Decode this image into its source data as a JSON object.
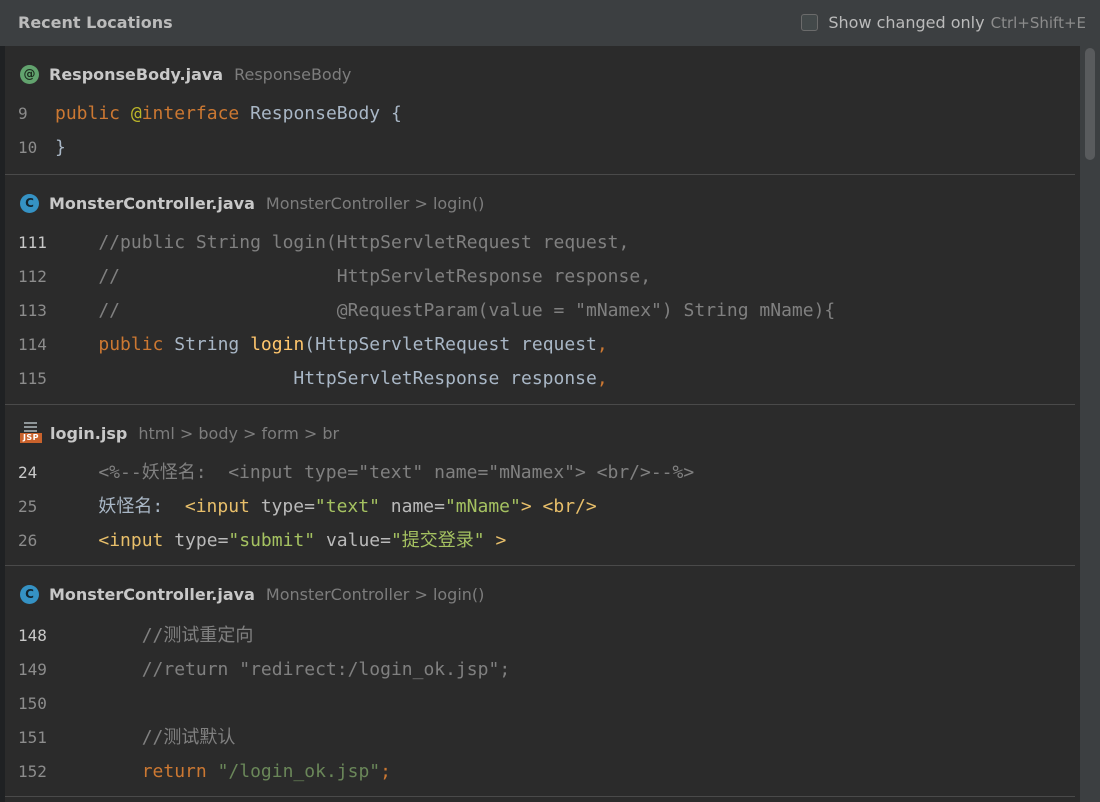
{
  "header": {
    "title": "Recent Locations",
    "checkbox_label": "Show changed only",
    "shortcut": "Ctrl+Shift+E"
  },
  "cards": [
    {
      "file": "ResponseBody.java",
      "crumb": "ResponseBody",
      "icon": "annotation-icon",
      "lines": [
        {
          "num": "9",
          "tokens": [
            [
              "public",
              "kw"
            ],
            [
              " ",
              "pl"
            ],
            [
              "@",
              "an"
            ],
            [
              "interface",
              "kw"
            ],
            [
              " ResponseBody {",
              "pl"
            ]
          ]
        },
        {
          "num": "10",
          "tokens": [
            [
              "}",
              "pl"
            ]
          ]
        }
      ]
    },
    {
      "file": "MonsterController.java",
      "crumb": "MonsterController > login()",
      "icon": "class-icon",
      "lines": [
        {
          "num": "111",
          "tokens": [
            [
              "    //public String login(HttpServletRequest request,",
              "cm"
            ]
          ]
        },
        {
          "num": "112",
          "tokens": [
            [
              "    //                    HttpServletResponse response,",
              "cm"
            ]
          ]
        },
        {
          "num": "113",
          "tokens": [
            [
              "    //                    @RequestParam(value = \"mNamex\") String mName){",
              "cm"
            ]
          ]
        },
        {
          "num": "114",
          "tokens": [
            [
              "    ",
              "pl"
            ],
            [
              "public",
              "kw"
            ],
            [
              " String ",
              "pl"
            ],
            [
              "login",
              "fn"
            ],
            [
              "(HttpServletRequest request",
              "pl"
            ],
            [
              ",",
              "kw"
            ]
          ]
        },
        {
          "num": "115",
          "tokens": [
            [
              "                      HttpServletResponse response",
              "pl"
            ],
            [
              ",",
              "kw"
            ]
          ]
        }
      ]
    },
    {
      "file": "login.jsp",
      "crumb": "html > body > form > br",
      "icon": "jsp-file-icon",
      "lines": [
        {
          "num": "24",
          "tokens": [
            [
              "    <%--妖怪名:  <input type=\"text\" name=\"mNamex\"> <br/>--%>",
              "cm"
            ]
          ]
        },
        {
          "num": "25",
          "tokens": [
            [
              "    妖怪名:  ",
              "pl"
            ],
            [
              "<input ",
              "tg"
            ],
            [
              "type=",
              "at"
            ],
            [
              "\"text\"",
              "av"
            ],
            [
              " name=",
              "at"
            ],
            [
              "\"mName\"",
              "av"
            ],
            [
              "> ",
              "tg"
            ],
            [
              "<br/>",
              "tg"
            ]
          ]
        },
        {
          "num": "26",
          "tokens": [
            [
              "    ",
              "pl"
            ],
            [
              "<input ",
              "tg"
            ],
            [
              "type=",
              "at"
            ],
            [
              "\"submit\"",
              "av"
            ],
            [
              " value=",
              "at"
            ],
            [
              "\"提交登录\"",
              "av"
            ],
            [
              " >",
              "tg"
            ]
          ]
        }
      ]
    },
    {
      "file": "MonsterController.java",
      "crumb": "MonsterController > login()",
      "icon": "class-icon",
      "lines": [
        {
          "num": "148",
          "tokens": [
            [
              "        //测试重定向",
              "cm"
            ]
          ]
        },
        {
          "num": "149",
          "tokens": [
            [
              "        //return \"redirect:/login_ok.jsp\";",
              "cm"
            ]
          ]
        },
        {
          "num": "150",
          "tokens": [
            [
              "",
              "pl"
            ]
          ]
        },
        {
          "num": "151",
          "tokens": [
            [
              "        //测试默认",
              "cm"
            ]
          ]
        },
        {
          "num": "152",
          "tokens": [
            [
              "        ",
              "pl"
            ],
            [
              "return",
              "kw"
            ],
            [
              " ",
              "pl"
            ],
            [
              "\"/login_ok.jsp\"",
              "st"
            ],
            [
              ";",
              "kw"
            ]
          ]
        }
      ]
    }
  ]
}
